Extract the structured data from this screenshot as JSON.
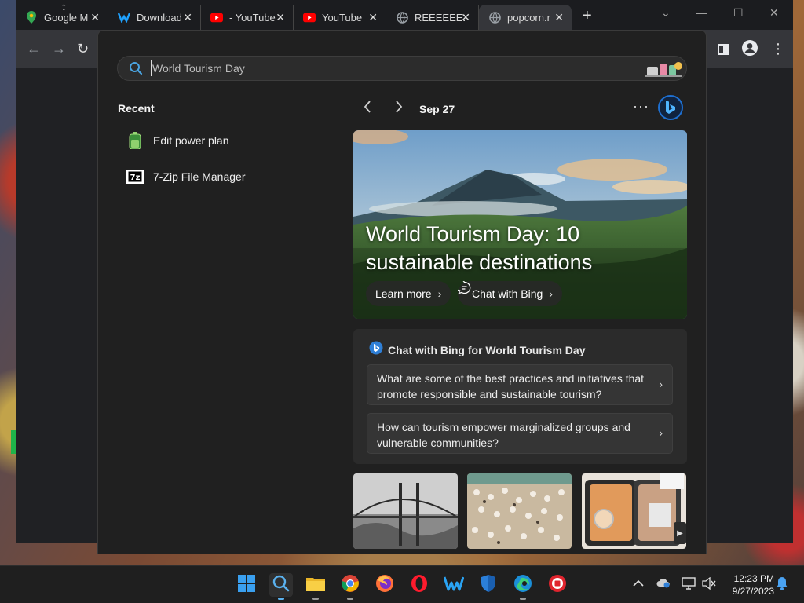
{
  "browser": {
    "tabs": [
      {
        "label": "Google M",
        "icon": "google-maps-icon",
        "color": "#34a853"
      },
      {
        "label": "Download",
        "icon": "download-site-icon",
        "color": "#1fa2ff"
      },
      {
        "label": "- YouTube",
        "icon": "youtube-icon",
        "color": "#ff0000"
      },
      {
        "label": "YouTube",
        "icon": "youtube-icon",
        "color": "#ff0000"
      },
      {
        "label": "REEEEEE1",
        "icon": "globe-icon",
        "color": "#9aa0a6"
      },
      {
        "label": "popcorn.r",
        "icon": "globe-icon",
        "color": "#9aa0a6"
      }
    ],
    "new_tab": "+"
  },
  "search": {
    "value": "",
    "placeholder": "World Tourism Day"
  },
  "recent": {
    "title": "Recent",
    "items": [
      {
        "label": "Edit power plan",
        "icon": "battery-icon"
      },
      {
        "label": "7-Zip File Manager",
        "icon": "seven-zip-icon"
      }
    ]
  },
  "highlights": {
    "date": "Sep 27",
    "more": "···",
    "hero": {
      "title": "World Tourism Day: 10 sustainable destinations",
      "learn_more": "Learn more",
      "chat_with_bing": "Chat with Bing"
    },
    "chat_card": {
      "title": "Chat with Bing for World Tourism Day",
      "questions": [
        "What are some of the best practices and initiatives that promote responsible and sustainable tourism?",
        "How can tourism empower marginalized groups and vulnerable communities?"
      ]
    }
  },
  "taskbar": {
    "apps": [
      "start-icon",
      "search-icon",
      "file-explorer-icon",
      "chrome-icon",
      "firefox-icon",
      "opera-icon",
      "wps-icon",
      "defender-icon",
      "edge-icon",
      "app-icon"
    ],
    "time": "12:23 PM",
    "date": "9/27/2023"
  },
  "colors": {
    "accent": "#1e6fd0",
    "panel_bg": "#202020",
    "card_bg": "#2b2b2b"
  }
}
